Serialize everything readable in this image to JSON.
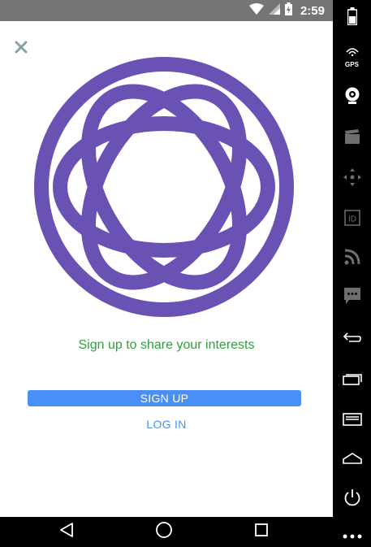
{
  "status_bar": {
    "time": "2:59",
    "icons": [
      "wifi-icon",
      "signal-icon",
      "battery-charging-icon"
    ]
  },
  "app": {
    "close_icon": "close-icon",
    "logo": "interests-logo",
    "tagline": "Sign up to share your interests",
    "signup_label": "SIGN UP",
    "login_label": "LOG IN",
    "colors": {
      "logo": "#6a52b5",
      "tagline": "#2e9e3e",
      "accent": "#4a8ff5"
    }
  },
  "emulator_toolbar": {
    "gps_label": "GPS",
    "items": [
      "battery-icon",
      "gps-icon",
      "camera-icon",
      "media-icon",
      "dpad-icon",
      "id-icon",
      "rss-icon",
      "sms-icon",
      "back-icon",
      "recents-icon",
      "menu-icon",
      "home-icon",
      "power-icon",
      "more-icon"
    ]
  },
  "nav_bar": {
    "items": [
      "back-icon",
      "home-icon",
      "recents-icon"
    ]
  }
}
